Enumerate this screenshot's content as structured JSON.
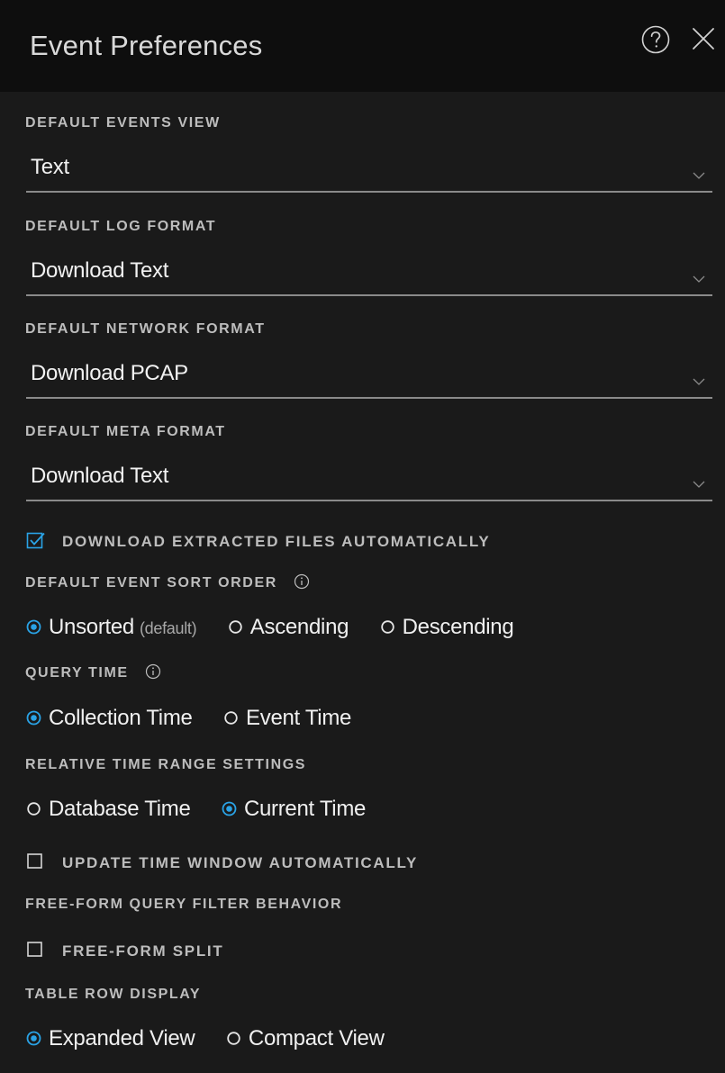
{
  "panel": {
    "title": "Event Preferences"
  },
  "default_events_view": {
    "label": "DEFAULT EVENTS VIEW",
    "value": "Text"
  },
  "default_log_format": {
    "label": "DEFAULT LOG FORMAT",
    "value": "Download Text"
  },
  "default_network_format": {
    "label": "DEFAULT NETWORK FORMAT",
    "value": "Download PCAP"
  },
  "default_meta_format": {
    "label": "DEFAULT META FORMAT",
    "value": "Download Text"
  },
  "download_extracted": {
    "label": "DOWNLOAD EXTRACTED FILES AUTOMATICALLY",
    "checked": true
  },
  "sort_order": {
    "label": "DEFAULT EVENT SORT ORDER",
    "options": [
      {
        "label": "Unsorted",
        "hint": "(default)",
        "selected": true
      },
      {
        "label": "Ascending",
        "selected": false
      },
      {
        "label": "Descending",
        "selected": false
      }
    ]
  },
  "query_time": {
    "label": "QUERY TIME",
    "options": [
      {
        "label": "Collection Time",
        "selected": true
      },
      {
        "label": "Event Time",
        "selected": false
      }
    ]
  },
  "relative_time": {
    "label": "RELATIVE TIME RANGE SETTINGS",
    "options": [
      {
        "label": "Database Time",
        "selected": false
      },
      {
        "label": "Current Time",
        "selected": true
      }
    ]
  },
  "update_time_window": {
    "label": "UPDATE TIME WINDOW AUTOMATICALLY",
    "checked": false
  },
  "free_form": {
    "label": "FREE-FORM QUERY FILTER BEHAVIOR",
    "split_label": "FREE-FORM SPLIT",
    "split_checked": false
  },
  "table_row_display": {
    "label": "TABLE ROW DISPLAY",
    "options": [
      {
        "label": "Expanded View",
        "selected": true
      },
      {
        "label": "Compact View",
        "selected": false
      }
    ]
  },
  "colors": {
    "accent": "#2aa3e6",
    "background": "#1a1a1a",
    "header": "#0e0e0e"
  }
}
